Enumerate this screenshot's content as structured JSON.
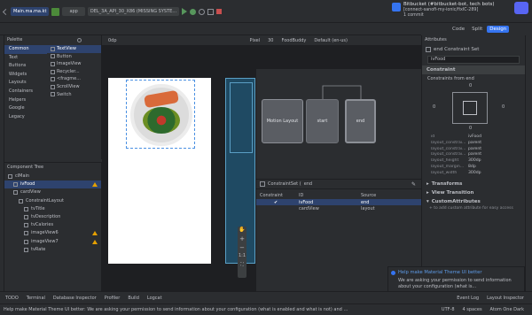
{
  "toolbar": {
    "project_tab": "Main.ma.ma.kt",
    "run_config": "app",
    "device": "DEL_3A_API_30_X86 (MISSING SYSTE...",
    "bitbucket": {
      "title": "Bitbucket (#bitbucket-bot, tech bots)",
      "line1": "[connect-sanofi-my-ionic/fixIC-289]",
      "line2": "1 commit"
    }
  },
  "editor": {
    "view_modes": [
      "Code",
      "Split",
      "Design"
    ],
    "active_view": "Design",
    "surface_toolbar": {
      "zoom_label": "0dp",
      "device": "Pixel",
      "api": "30",
      "theme": "FoodBuddy",
      "locale": "Default (en-us)"
    }
  },
  "palette": {
    "title": "Palette",
    "categories": [
      "Common",
      "Text",
      "Buttons",
      "Widgets",
      "Layouts",
      "Containers",
      "Helpers",
      "Google",
      "Legacy"
    ],
    "selected_category": "Common",
    "items": [
      "TextView",
      "Button",
      "ImageView",
      "Recycler...",
      "<fragme...",
      "ScrollView",
      "Switch"
    ]
  },
  "component_tree": {
    "title": "Component Tree",
    "nodes": [
      {
        "label": "clMain",
        "depth": 0,
        "warn": false,
        "selected": false
      },
      {
        "label": "ivFood",
        "depth": 1,
        "warn": true,
        "selected": true
      },
      {
        "label": "cardView",
        "depth": 1,
        "warn": false,
        "selected": false
      },
      {
        "label": "ConstraintLayout",
        "depth": 2,
        "warn": false,
        "selected": false
      },
      {
        "label": "tvTitle",
        "depth": 3,
        "warn": false,
        "selected": false
      },
      {
        "label": "tvDescription",
        "depth": 3,
        "warn": false,
        "selected": false
      },
      {
        "label": "tvCalories",
        "depth": 3,
        "warn": false,
        "selected": false
      },
      {
        "label": "imageView6",
        "depth": 3,
        "warn": true,
        "selected": false
      },
      {
        "label": "imageView7",
        "depth": 3,
        "warn": true,
        "selected": false
      },
      {
        "label": "tvRate",
        "depth": 3,
        "warn": false,
        "selected": false
      }
    ]
  },
  "motion": {
    "cards": [
      "Motion Layout",
      "start",
      "end"
    ],
    "constraint_set_title": "ConstraintSet (",
    "constraint_set_name": "end",
    "table_headers": [
      "Constraint",
      "ID",
      "Source"
    ],
    "rows": [
      {
        "check": "✔",
        "id": "ivFood",
        "source": "end"
      },
      {
        "check": "",
        "id": "cardView",
        "source": "layout"
      }
    ]
  },
  "attributes": {
    "title": "Attributes",
    "header": "end Constraint Set",
    "id_value": "ivFood",
    "constraint_section": "Constraint",
    "constraints_from": "Constraints from end",
    "margin_top": "0",
    "margin_left": "0",
    "margin_right": "0",
    "margin_bottom": "0",
    "rows": [
      {
        "k": "id",
        "v": "ivFood"
      },
      {
        "k": "layout_constrai...",
        "v": "parent"
      },
      {
        "k": "layout_constrai...",
        "v": "parent"
      },
      {
        "k": "layout_constrai...",
        "v": "parent"
      },
      {
        "k": "layout_height",
        "v": "300dp"
      },
      {
        "k": "layout_margin...",
        "v": "8dp"
      },
      {
        "k": "layout_width",
        "v": "300dp"
      }
    ],
    "sections": [
      "Transforms",
      "View Transition",
      "CustomAttributes"
    ],
    "custom_hint": "+ to add custom attribute for easy access"
  },
  "notification": {
    "title": "Help make Material Theme UI better",
    "body": "We are asking your permission to send information about your configuration (what is..."
  },
  "bottom_tools": [
    "TODO",
    "Terminal",
    "Database Inspector",
    "Profiler",
    "Build",
    "Logcat"
  ],
  "bottom_tools_right": [
    "Event Log",
    "Layout Inspector"
  ],
  "status": {
    "message": "Help make Material Theme UI better: We are asking your permission to send information about your configuration (what is enabled and what is not) and feature usage statistics (e.g. how frequently yo... (5 minutes ago)",
    "encoding": "UTF-8",
    "indent": "4 spaces",
    "theme": "Atom One Dark"
  },
  "colors": {
    "accent": "#3574f0",
    "warn": "#e5a000",
    "selection": "#2e436e",
    "blueprint": "#1f4a63"
  }
}
